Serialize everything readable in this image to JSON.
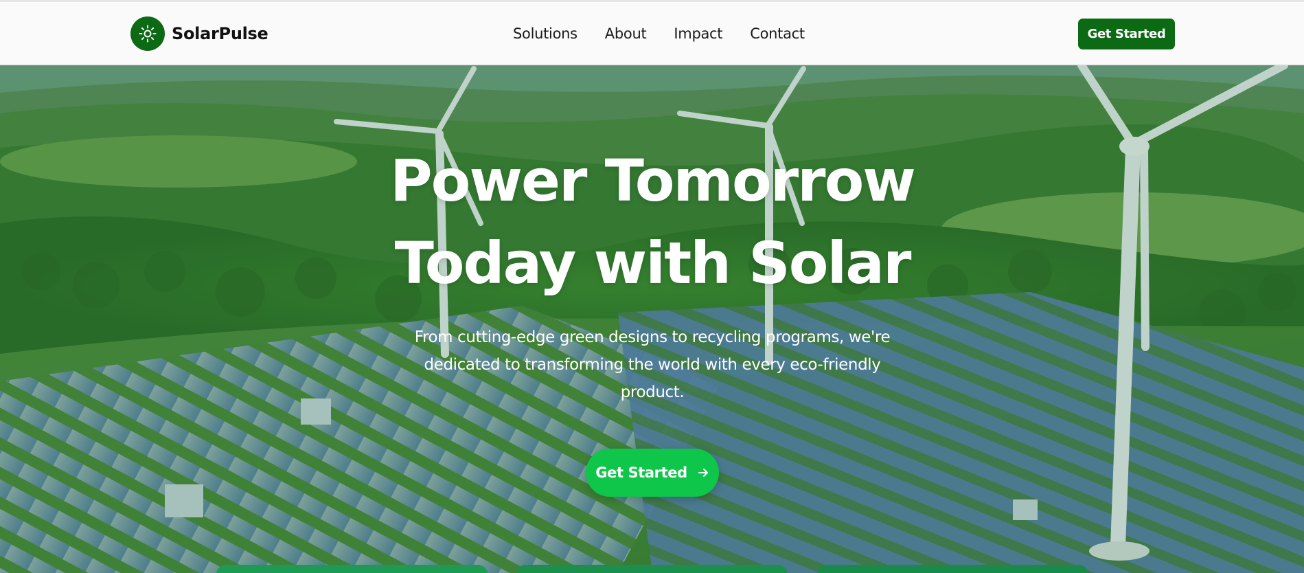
{
  "header": {
    "brand": "SolarPulse",
    "nav": [
      "Solutions",
      "About",
      "Impact",
      "Contact"
    ],
    "cta_label": "Get Started"
  },
  "hero": {
    "title_line1": "Power Tomorrow",
    "title_line2": "Today with Solar",
    "subtitle_line1": "From cutting-edge green designs to recycling programs, we're",
    "subtitle_line2": "dedicated to transforming the world with every eco-friendly",
    "subtitle_line3": "product.",
    "cta_label": "Get Started",
    "background_image": "Aerial view of solar panel farm with wind turbines among green hills"
  },
  "colors": {
    "brand_green": "#0d6a14",
    "cta_green": "#0ec64a",
    "header_bg": "#fafafa",
    "text_dark": "#1a1a1a"
  },
  "icons": {
    "logo": "sun-icon",
    "cta": "arrow-right-icon"
  }
}
